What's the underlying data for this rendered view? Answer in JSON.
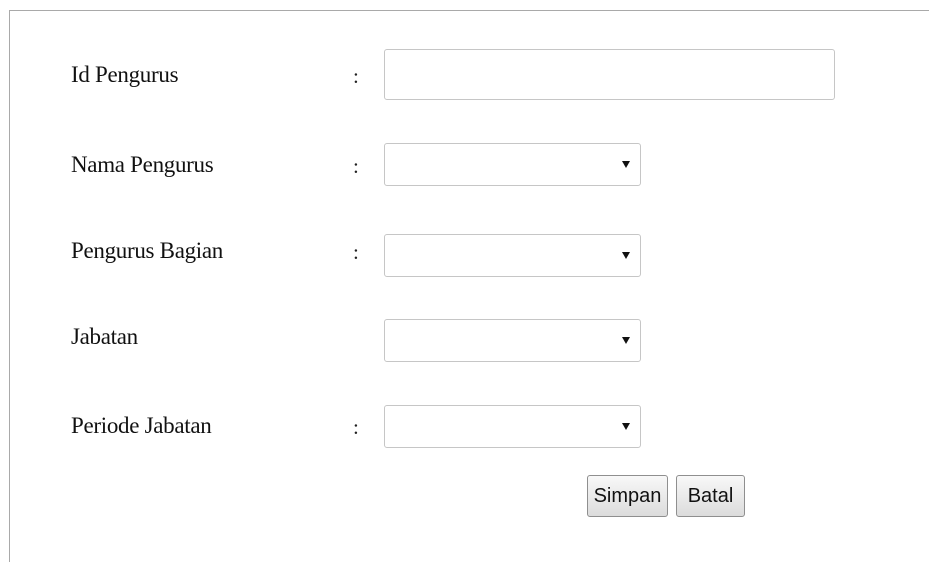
{
  "form": {
    "fields": [
      {
        "label": "Id Pengurus",
        "colon": ":",
        "type": "text",
        "value": ""
      },
      {
        "label": "Nama Pengurus",
        "colon": ":",
        "type": "select",
        "value": ""
      },
      {
        "label": "Pengurus Bagian",
        "colon": ":",
        "type": "select",
        "value": ""
      },
      {
        "label": "Jabatan",
        "colon": "",
        "type": "select",
        "value": ""
      },
      {
        "label": "Periode Jabatan",
        "colon": ":",
        "type": "select",
        "value": ""
      }
    ],
    "buttons": {
      "save_label": "Simpan",
      "cancel_label": "Batal"
    }
  },
  "icons": {
    "dropdown": "chevron-down-icon"
  }
}
